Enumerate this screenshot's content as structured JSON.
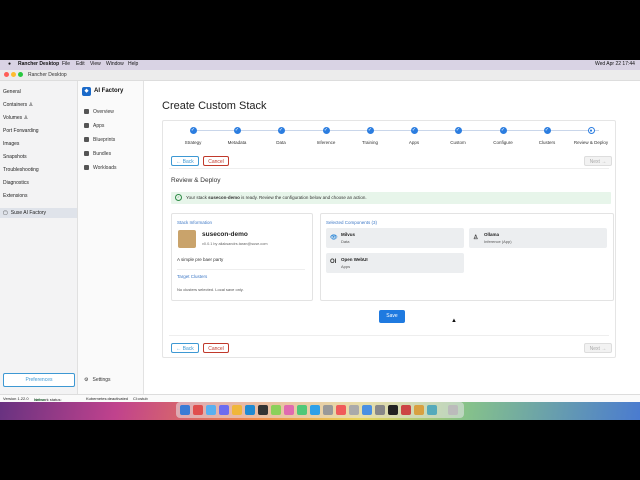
{
  "menubar": {
    "app": "Rancher Desktop",
    "items": [
      "File",
      "Edit",
      "View",
      "Window",
      "Help"
    ],
    "clock": "Wed Apr 22  17:44"
  },
  "window": {
    "title": "Rancher Desktop"
  },
  "leftnav": {
    "items": [
      "General",
      "Containers",
      "Volumes",
      "Port Forwarding",
      "Images",
      "Snapshots",
      "Troubleshooting",
      "Diagnostics",
      "Extensions"
    ],
    "active_item": "Suse AI Factory",
    "preferences_label": "Preferences"
  },
  "statusbar": {
    "version": "Version 1.22.0",
    "network_label": "Network status:",
    "network_value": "online",
    "kubernetes": "Kubernetes:deactivated",
    "ci": "CI:cstub"
  },
  "secnav": {
    "brand": "AI Factory",
    "items": [
      "Overview",
      "Apps",
      "Blueprints",
      "Bundles",
      "Workloads"
    ],
    "settings": "Settings"
  },
  "main": {
    "title": "Create Custom Stack",
    "steps": [
      "Strategy",
      "Metadata",
      "Data",
      "Inference",
      "Training",
      "Apps",
      "Custom",
      "Configure",
      "Clusters",
      "Review & Deploy"
    ],
    "back_label": "Back",
    "cancel_label": "Cancel",
    "next_label": "Next",
    "section_title": "Review & Deploy",
    "banner_prefix": "Your stack ",
    "banner_name": "susecon-demo",
    "banner_suffix": " is ready. Review the configuration below and choose an action.",
    "stack_info_label": "Stack Information",
    "stack_name": "susecon-demo",
    "stack_meta": "v0.0.1 by aliaksandrs.taran@suse.com",
    "stack_desc": "A simple pre baer party",
    "target_clusters_label": "Target Clusters",
    "no_clusters": "No clusters selected. Local save only.",
    "selected_components_label": "Selected Components (3)",
    "components": [
      {
        "name": "Milvus",
        "type": "Data",
        "icon": "eye-icon"
      },
      {
        "name": "Ollama",
        "type": "Inference (App)",
        "icon": "llama-icon"
      },
      {
        "name": "Open WebUI",
        "type": "Apps",
        "icon": "OI"
      }
    ],
    "save_label": "Save"
  }
}
